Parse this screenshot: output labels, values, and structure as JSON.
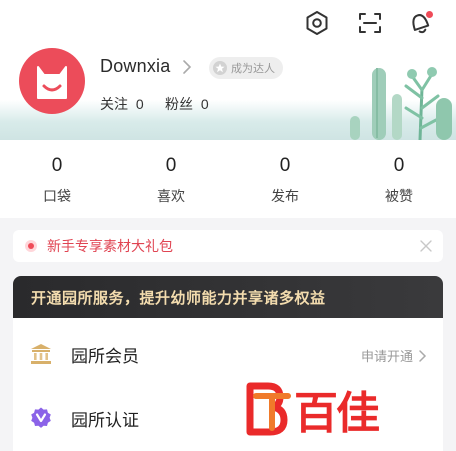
{
  "profile": {
    "username": "Downxia",
    "badge_label": "成为达人",
    "following_label": "关注",
    "following_count": "0",
    "followers_label": "粉丝",
    "followers_count": "0"
  },
  "top_icons": [
    "settings-icon",
    "scan-icon",
    "notification-bell-icon"
  ],
  "notification_dot": true,
  "stats": [
    {
      "value": "0",
      "label": "口袋"
    },
    {
      "value": "0",
      "label": "喜欢"
    },
    {
      "value": "0",
      "label": "发布"
    },
    {
      "value": "0",
      "label": "被赞"
    }
  ],
  "promo": {
    "text": "新手专享素材大礼包"
  },
  "vip_banner": {
    "text": "开通园所服务，提升幼师能力并享诸多权益"
  },
  "menu": [
    {
      "label": "园所会员",
      "action": "申请开通",
      "icon": "institution-icon"
    },
    {
      "label": "园所认证",
      "icon": "verified-icon"
    }
  ],
  "watermark": {
    "text": "百佳"
  },
  "colors": {
    "accent": "#ec4c5a",
    "promo_text": "#e04452",
    "vip_bg": "#2a2a2c",
    "vip_text": "#f3dcae",
    "watermark": "#ea2a2a"
  }
}
